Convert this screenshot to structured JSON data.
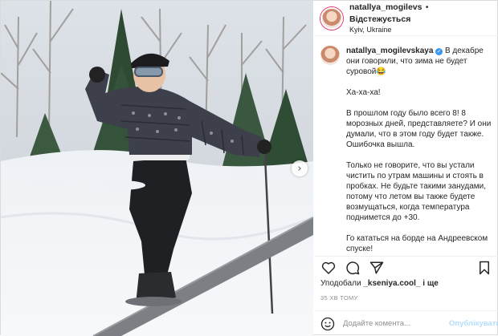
{
  "header": {
    "username": "natallya_mogilevs",
    "separator": "•",
    "follow_label": "Відстежується",
    "location": "Kyiv, Ukraine"
  },
  "caption": {
    "username": "natallya_mogilevskaya",
    "verified_icon": "verified-badge-icon",
    "paragraphs": [
      "В декабре они говорили, что зима не будет суровой😂",
      "Ха-ха-ха!",
      "В прошлом году было всего 8! 8 морозных дней, представляете? И они думали, что в этом году будет также. Ошибочка вышла.",
      "Только не говорите, что вы устали чистить по утрам машины и стоять в пробках. Не будьте такими занудами, потому что летом вы также будете возмущаться, когда температура поднимется до +30.",
      "Го кататься на борде на Андреевском спуске!"
    ]
  },
  "actions": {
    "like_icon": "heart-icon",
    "comment_icon": "comment-icon",
    "share_icon": "share-icon",
    "save_icon": "bookmark-icon"
  },
  "likes": {
    "prefix": "Уподобали",
    "user": "_kseniya.cool_",
    "suffix": "і ще"
  },
  "timestamp": "35 ХВ ТОМУ",
  "comment": {
    "emoji_icon": "smiley-icon",
    "placeholder": "Додайте комента...",
    "post_label": "Опублікувати"
  },
  "photo": {
    "next_icon": "chevron-right-icon",
    "next_glyph": "›"
  },
  "colors": {
    "verified": "#3897f0",
    "post_disabled": "#b2dffc",
    "muted": "#8e8e8e",
    "story_ring": "#e1306c"
  }
}
